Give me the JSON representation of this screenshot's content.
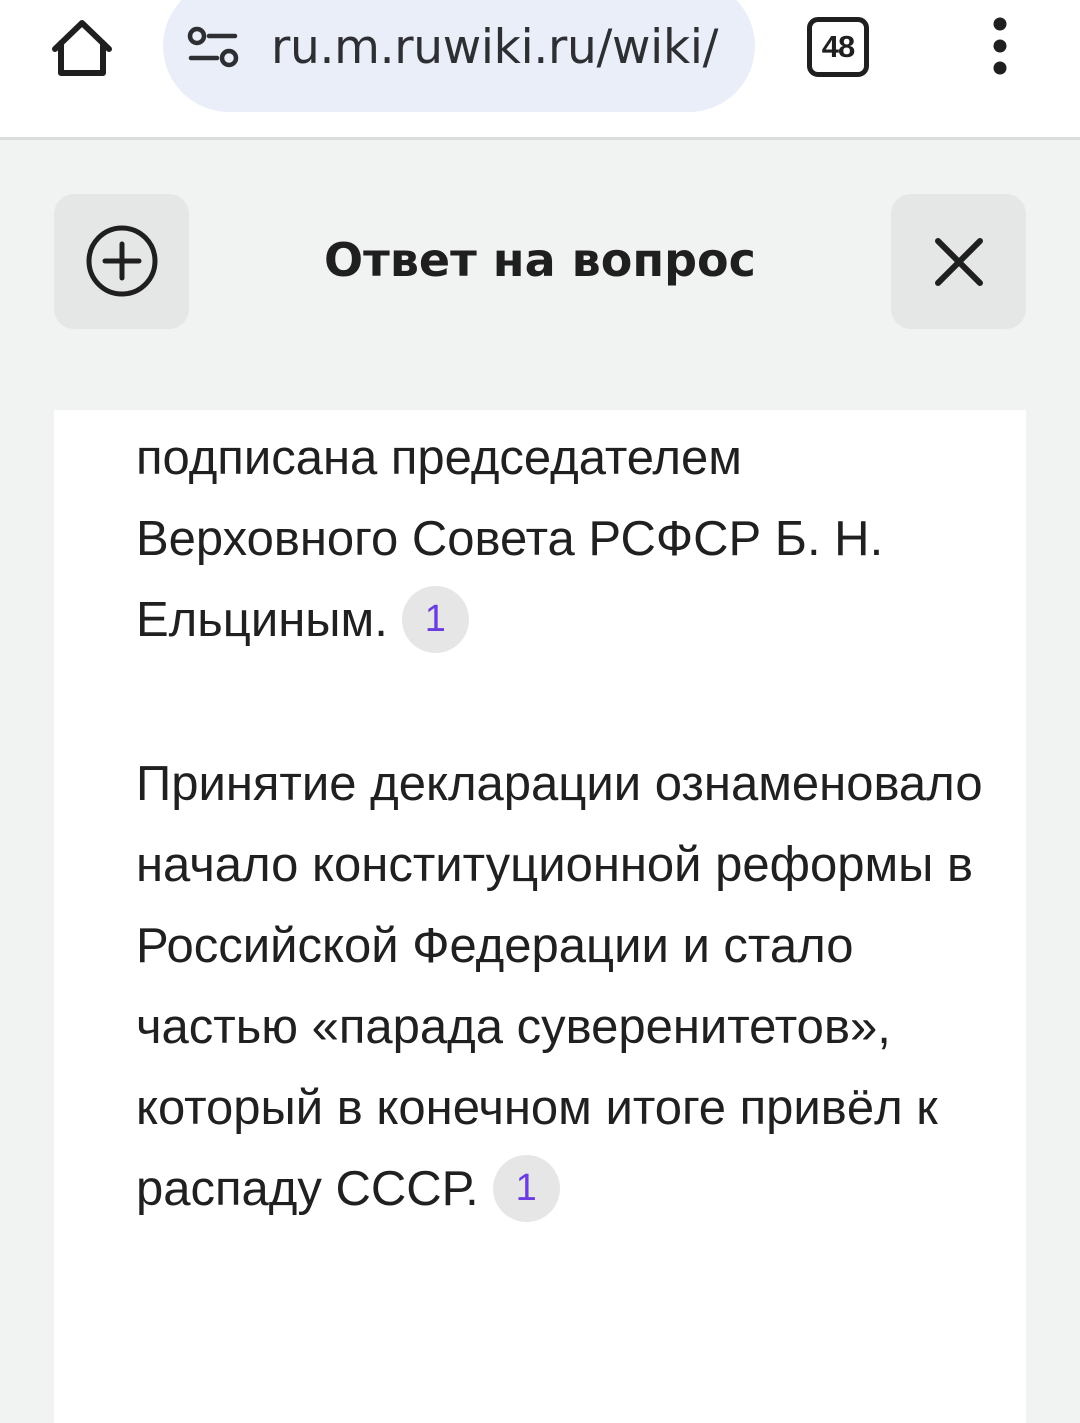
{
  "browser": {
    "url": "ru.m.ruwiki.ru/wiki/",
    "tab_count": "48"
  },
  "header": {
    "title": "Ответ на вопрос"
  },
  "answer": {
    "paragraphs": [
      {
        "text": "подписана председателем Верховного Совета РСФСР Б. Н. Ельциным.",
        "citation": "1"
      },
      {
        "text": "Принятие декларации ознаменовало начало конституционной реформы в Российской Федерации и стало частью «парада суверенитетов», который в конечном итоге привёл к распаду СССР.",
        "citation": "1"
      }
    ]
  },
  "colors": {
    "browser_bar": "#ffffff",
    "url_pill": "#e9eef8",
    "page_background": "#f1f3f2",
    "card_background": "#ffffff",
    "citation_text": "#6b3ce0",
    "citation_background": "#e6e6e6"
  },
  "icons": {
    "home": "home-icon",
    "site_info": "tune-icon",
    "menu": "more-vertical-icon",
    "add": "plus-circle-icon",
    "close": "close-icon"
  }
}
